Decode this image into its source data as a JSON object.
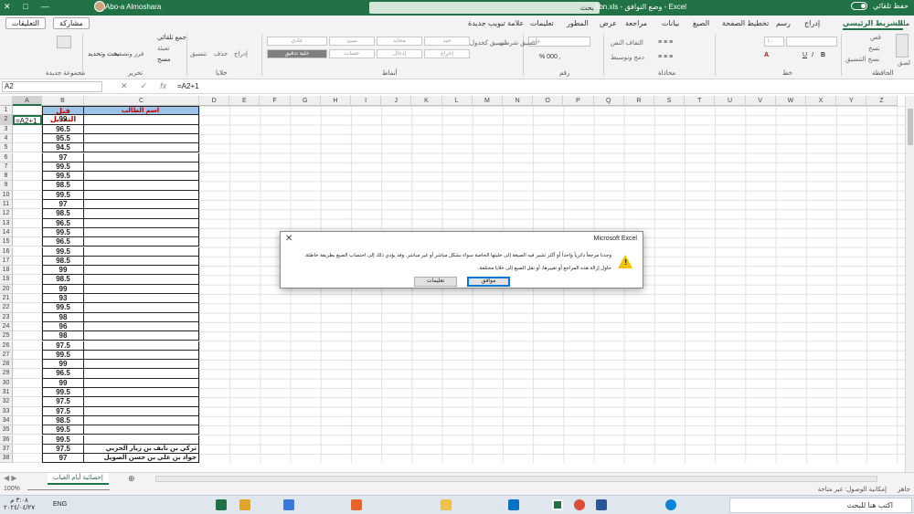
{
  "titlebar": {
    "autosave": "حفظ تلقائي",
    "filename": "Abn.xls  -  وضع التوافق  -  Excel",
    "search": "بحث",
    "user": "Abo-a Almoshara"
  },
  "menu": {
    "tabs": [
      "ملف",
      "الشريط الرئيسي",
      "إدراج",
      "رسم",
      "تخطيط الصفحة",
      "الصيغ",
      "بيانات",
      "مراجعة",
      "عرض",
      "المطور",
      "تعليمات",
      "علامة تبويب جديدة"
    ],
    "active_tab": "الشريط الرئيسي",
    "share": "مشاركة",
    "comments": "التعليقات"
  },
  "ribbon": {
    "groups": [
      "الحافظة",
      "خط",
      "محاذاة",
      "رقم",
      "أنماط",
      "خلايا",
      "تحرير",
      "مجموعة جديدة"
    ],
    "clipboard": [
      "قص",
      "نسخ",
      "نسخ التنسيق",
      "لصق"
    ],
    "font_size": "١٠",
    "number_format": "عام",
    "wrap": "التفاف النص",
    "merge": "دمج وتوسيط",
    "styles": [
      "جيد",
      "محايد",
      "سيئ",
      "عادي",
      "إخراج",
      "إدخال",
      "حساب",
      "خلية تدقيق",
      "تنسيق شرطي",
      "تنسيق كجدول"
    ],
    "cells": [
      "إدراج",
      "حذف",
      "تنسيق"
    ],
    "editing": [
      "جمع تلقائي",
      "تعبئة",
      "مسح",
      "فرز وتصفية",
      "بحث وتحديد"
    ]
  },
  "formula": {
    "namebox": "A2",
    "content": "=A2+1"
  },
  "columns": [
    "A",
    "B",
    "C",
    "D",
    "E",
    "F",
    "G",
    "H",
    "I",
    "J",
    "K",
    "L",
    "M",
    "N",
    "O",
    "P",
    "Q",
    "R",
    "S",
    "T",
    "U",
    "V",
    "W",
    "X",
    "Y",
    "Z"
  ],
  "rows": [
    "1",
    "2",
    "3",
    "4",
    "5",
    "6",
    "7",
    "8",
    "9",
    "10",
    "11",
    "12",
    "13",
    "14",
    "15",
    "16",
    "17",
    "18",
    "19",
    "20",
    "21",
    "22",
    "23",
    "24",
    "25",
    "26",
    "27",
    "28",
    "29",
    "30",
    "31",
    "32",
    "33",
    "34",
    "35",
    "36",
    "37",
    "38"
  ],
  "sheet": {
    "A2": "=A2+1",
    "B1": "قبل التعديل",
    "C1": "اسم الطالب",
    "B_values": [
      "99",
      "96.5",
      "95.5",
      "94.5",
      "97",
      "99.5",
      "99.5",
      "98.5",
      "99.5",
      "97",
      "98.5",
      "96.5",
      "99.5",
      "96.5",
      "99.5",
      "98.5",
      "99",
      "98.5",
      "99",
      "93",
      "99.5",
      "98",
      "96",
      "98",
      "97.5",
      "99.5",
      "99",
      "96.5",
      "99",
      "99.5",
      "97.5",
      "97.5",
      "98.5",
      "99.5",
      "99.5",
      "97.5",
      "97"
    ],
    "C37": "تركي بن نايف بن زبار الحربي",
    "C38": "جواد بن علي بن حسن الصويل"
  },
  "sheet_tab": "إحصائية أيام الغياب",
  "status": {
    "ready": "جاهز",
    "accessibility": "إمكانية الوصول: غير متاحة",
    "zoom": "100%"
  },
  "dialog": {
    "title": "Microsoft Excel",
    "message1": "وجدنا مرجعاً دائرياً واحداً أو أكثر تشير فيه الصيغة إلى خليتها الخاصة سواء بشكل مباشر أو غير مباشر. وقد يؤدي ذلك إلى احتساب الصيغ بطريقة خاطئة.",
    "message2": "حاول إزالة هذه المراجع أو تغييرها، أو نقل الصيغ إلى خلايا مختلفة.",
    "ok": "موافق",
    "help": "تعليمات"
  },
  "taskbar": {
    "search": "اكتب هنا للبحث",
    "time": "٣:٠٨ م",
    "date": "٢٠٢٤/٠٤/٢٧",
    "lang": "ENG"
  }
}
